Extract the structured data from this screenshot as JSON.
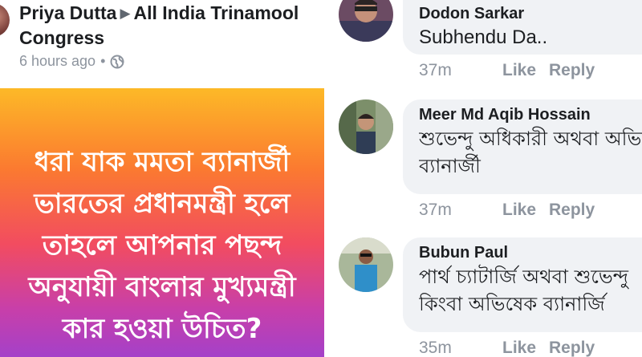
{
  "post": {
    "author": "Priya Dutta",
    "group": "All India Trinamool Congress",
    "group_line2": "Congress",
    "group_line1": "All India Trinamool",
    "time": "6 hours ago",
    "icons": {
      "separator": "•",
      "privacy": "globe-icon",
      "arrow": "play-arrow-icon"
    },
    "text_lines": [
      "ধরা যাক মমতা ব্যানার্জী",
      "ভারতের প্রধানমন্ত্রী হলে",
      "তাহলে আপনার পছন্দ",
      "অনুযায়ী বাংলার মুখ্যমন্ত্রী",
      "কার হওয়া উচিত?"
    ],
    "colors": {
      "gradient_top": "#fdb927",
      "gradient_bottom": "#a441c9"
    }
  },
  "comments": [
    {
      "name": "Dodon Sarkar",
      "lines": [
        "Subhendu Da.."
      ],
      "time": "37m",
      "like": "Like",
      "reply": "Reply"
    },
    {
      "name": "Meer Md Aqib Hossain",
      "lines": [
        "শুভেন্দু অধিকারী অথবা অভিষেক",
        "ব্যানার্জী"
      ],
      "time": "37m",
      "like": "Like",
      "reply": "Reply"
    },
    {
      "name": "Bubun Paul",
      "lines": [
        "পার্থ চ্যাটার্জি অথবা শুভেন্দু",
        "কিংবা অভিষেক ব্যানার্জি"
      ],
      "time": "35m",
      "like": "Like",
      "reply": "Reply"
    }
  ]
}
